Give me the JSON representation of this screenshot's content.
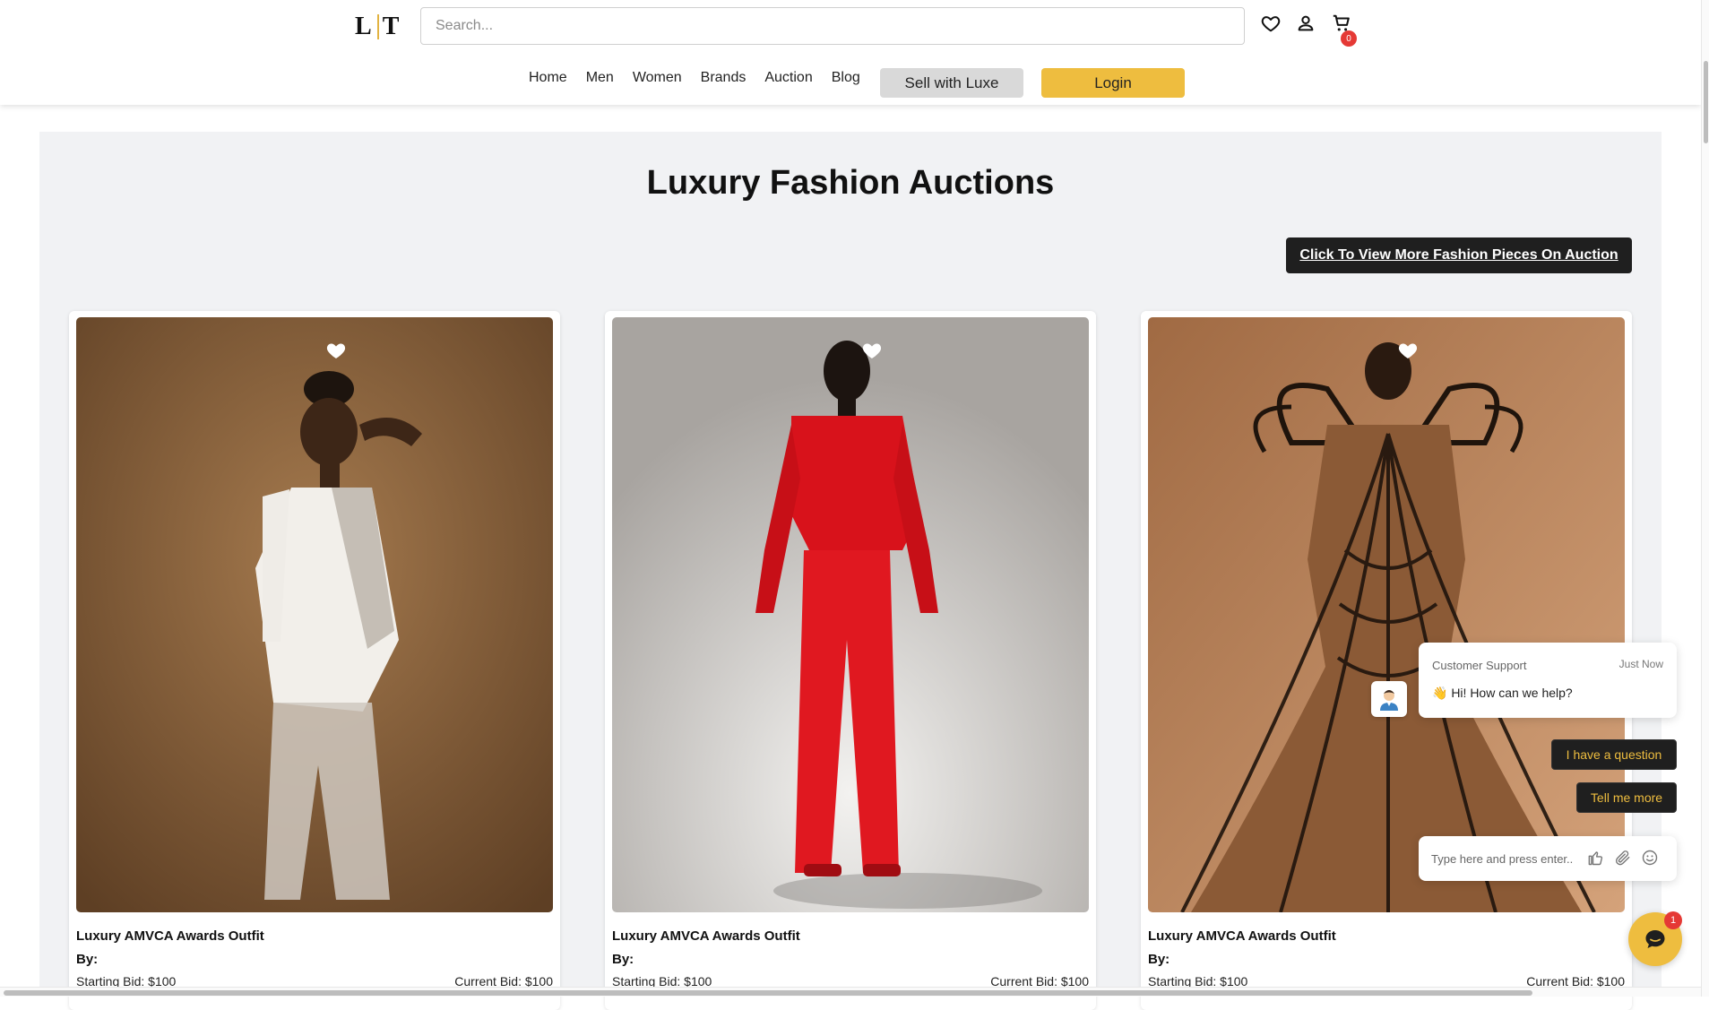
{
  "header": {
    "logo_text": "L T",
    "search_placeholder": "Search...",
    "icons": [
      "heart-icon",
      "user-icon",
      "cart-icon"
    ],
    "cart_count": "0",
    "nav": [
      "Home",
      "Men",
      "Women",
      "Brands",
      "Auction",
      "Blog"
    ],
    "sell_label": "Sell with Luxe",
    "login_label": "Login"
  },
  "main": {
    "title": "Luxury Fashion Auctions",
    "more_button": "Click To View More Fashion Pieces On Auction",
    "cards": [
      {
        "name": "Luxury AMVCA Awards Outfit",
        "by": "By:",
        "starting_bid": "Starting Bid: $100",
        "current_bid": "Current Bid: $100"
      },
      {
        "name": "Luxury AMVCA Awards Outfit",
        "by": "By:",
        "starting_bid": "Starting Bid: $100",
        "current_bid": "Current Bid: $100"
      },
      {
        "name": "Luxury AMVCA Awards Outfit",
        "by": "By:",
        "starting_bid": "Starting Bid: $100",
        "current_bid": "Current Bid: $100"
      }
    ]
  },
  "chat": {
    "agent": "Customer Support",
    "time": "Just Now",
    "message": "👋 Hi! How can we help?",
    "chip_question": "I have a question",
    "chip_more": "Tell me more",
    "input_placeholder": "Type here and press enter..",
    "unread": "1"
  },
  "colors": {
    "accent": "#eebd3f",
    "dark": "#1f1f1f",
    "badge": "#e53935",
    "panel": "#f1f2f4"
  }
}
